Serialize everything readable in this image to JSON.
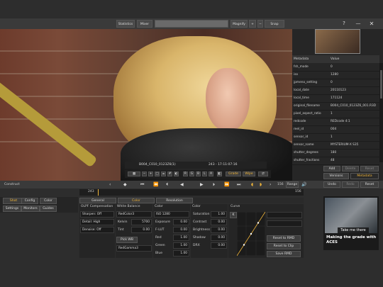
{
  "toolbar": {
    "statistics": "Statistics",
    "mixer": "Mixer",
    "magnify": "Magnify",
    "snap_shot": "Snap Shot..."
  },
  "viewer": {
    "clip_name": "B004_C010_0123Z6(1)",
    "timecode_info": "243  -  17:11:07:16",
    "transport_letters": [
      "R",
      "G",
      "B",
      "L",
      "A"
    ],
    "grade_label": "Grade",
    "wipe_label": "Wipe"
  },
  "metadata": {
    "header_key": "Metadata",
    "header_value": "Value",
    "rows": [
      {
        "k": "fsh_mode",
        "v": "0"
      },
      {
        "k": "iso",
        "v": "1280"
      },
      {
        "k": "jpmeno_setting",
        "v": "0"
      },
      {
        "k": "local_date",
        "v": "20110123"
      },
      {
        "k": "local_time",
        "v": "171124"
      },
      {
        "k": "original_filename",
        "v": "B004_C010_0123Z6_001.R3D"
      },
      {
        "k": "pixel_aspect_ratio",
        "v": "1"
      },
      {
        "k": "redcode",
        "v": "REDcode 4:1"
      },
      {
        "k": "reel_id",
        "v": "004"
      },
      {
        "k": "sensor_id",
        "v": "1"
      },
      {
        "k": "sensor_name",
        "v": "MYSTERIUM-X S35"
      },
      {
        "k": "shutter_degrees",
        "v": "180"
      },
      {
        "k": "shutter_fractions",
        "v": "48"
      }
    ],
    "tabs": [
      "Add",
      "Delete",
      "Reset"
    ],
    "subtabs": [
      "Versions",
      "Metadata"
    ],
    "actions": [
      "Undo",
      "Redo",
      "Reset"
    ]
  },
  "timeline": {
    "construct_label": "Construct",
    "frame_start": "243",
    "frame_end": "156",
    "range_label": "Range",
    "range_value": "156"
  },
  "left_tabs": [
    "Shot",
    "Config",
    "Color",
    "Settings",
    "Monitors",
    "Guides"
  ],
  "subtabs": [
    "General",
    "Color",
    "Resolution"
  ],
  "olpf": {
    "title": "OLPF Compensation",
    "items": [
      "Sharpen: Off",
      "Detail: High",
      "Denoise: Off"
    ]
  },
  "white_balance": {
    "title": "White Balance",
    "preset": "RedColor3",
    "kelvin_label": "Kelvin",
    "kelvin_value": "5700",
    "tint_label": "Tint",
    "tint_value": "0.00",
    "pick_wb": "Pick WB",
    "gamma": "RedGamma3"
  },
  "color": {
    "title": "Color",
    "iso_label": "ISO",
    "iso_value": "1280",
    "rows": [
      {
        "k": "Exposure",
        "v": "0.00"
      },
      {
        "k": "F-LUT",
        "v": "0.00"
      },
      {
        "k": "Red",
        "v": "1.00"
      },
      {
        "k": "Green",
        "v": "1.00"
      },
      {
        "k": "Blue",
        "v": "1.00"
      }
    ]
  },
  "color2": {
    "title": "Color",
    "rows": [
      {
        "k": "Saturation",
        "v": "1.00"
      },
      {
        "k": "Contrast",
        "v": "0.00"
      },
      {
        "k": "Brightness",
        "v": "0.00"
      },
      {
        "k": "Shadow",
        "v": "0.00"
      },
      {
        "k": "DRX",
        "v": "0.00"
      }
    ]
  },
  "curve": {
    "title": "Curve",
    "channel": "K",
    "reset_rmd": "Reset to RMD",
    "reset_clip": "Reset to Clip",
    "save_rmd": "Save RMD"
  },
  "ad": {
    "cta": "Take me there",
    "caption_line1": "Making the grade with",
    "caption_line2": "ACES"
  }
}
